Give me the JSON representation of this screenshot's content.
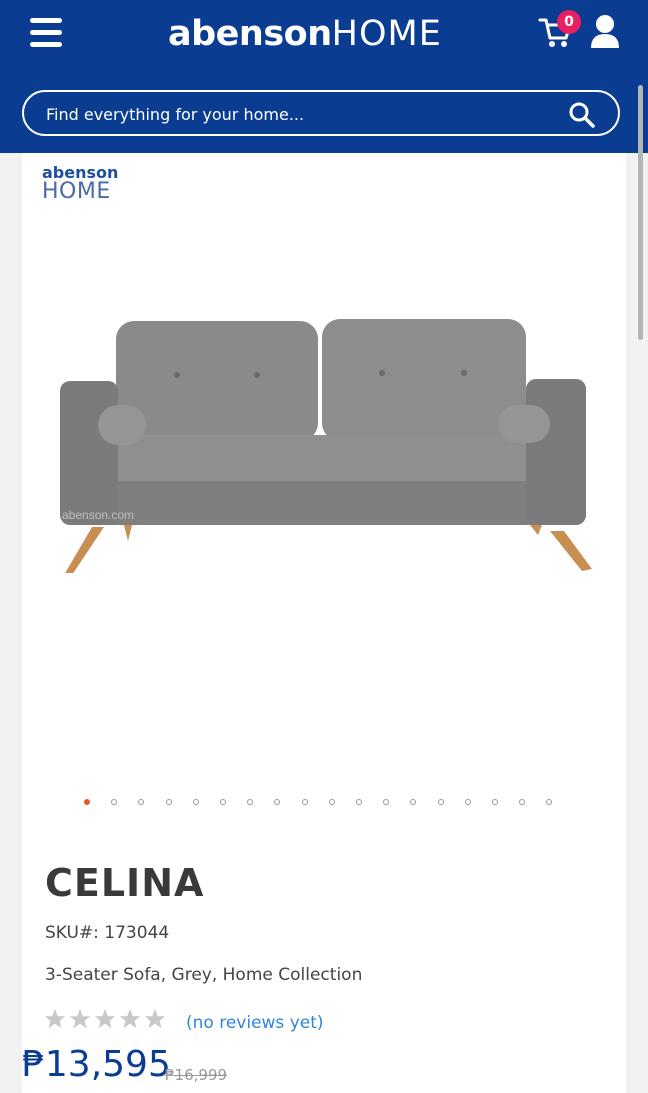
{
  "header": {
    "logo_part1": "abenson",
    "logo_part2": "HOME",
    "cart_count": "0"
  },
  "search": {
    "placeholder": "Find everything for your home..."
  },
  "product_image": {
    "brand_line1": "abenson",
    "brand_line2": "HOME",
    "watermark": "abenson.com",
    "slide_count": 18,
    "active_slide": 1
  },
  "product": {
    "title": "CELINA",
    "sku": "SKU#: 173044",
    "description": "3-Seater Sofa, Grey, Home Collection",
    "rating_stars": 5,
    "reviews_link": "(no reviews yet)",
    "price": "₱13,595",
    "old_price": "₱16,999"
  },
  "colors": {
    "brand_blue": "#0a3d91",
    "badge_pink": "#e91e63",
    "active_dot": "#e8572b",
    "link_blue": "#2e86de"
  }
}
